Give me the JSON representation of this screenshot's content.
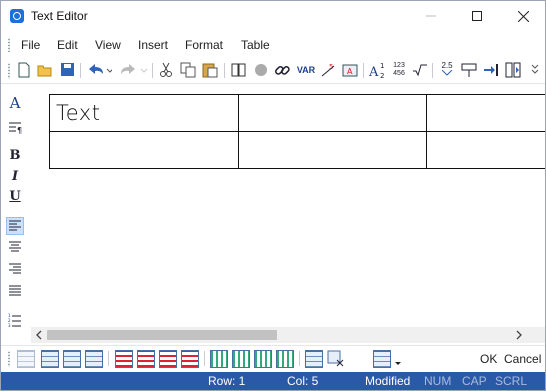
{
  "window": {
    "title": "Text Editor"
  },
  "menu": {
    "items": [
      "File",
      "Edit",
      "View",
      "Insert",
      "Format",
      "Table"
    ]
  },
  "toolbar": {
    "var_label": "VAR",
    "num_label": "123\n456",
    "frac_label": "2.5",
    "superscript_label": "1",
    "subscript_label": "2"
  },
  "left_toolbar": {
    "bold": "B",
    "italic": "I",
    "underline": "U",
    "font": "A"
  },
  "document": {
    "table": {
      "rows": [
        [
          "Text",
          "",
          ""
        ],
        [
          "",
          "",
          ""
        ]
      ]
    }
  },
  "bottom": {
    "ok_label": "OK",
    "cancel_label": "Cancel"
  },
  "status": {
    "row": "Row: 1",
    "col": "Col: 5",
    "modified": "Modified",
    "num": "NUM",
    "cap": "CAP",
    "scrl": "SCRL"
  },
  "colors": {
    "status_bar": "#2a5aa7",
    "accent": "#1e6fd9"
  }
}
